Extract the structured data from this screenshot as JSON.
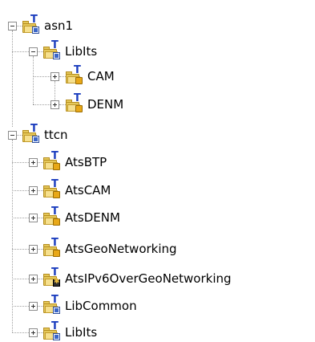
{
  "tree": {
    "asn1": {
      "label": "asn1",
      "children": {
        "libits": {
          "label": "LibIts",
          "children": {
            "cam": {
              "label": "CAM"
            },
            "denm": {
              "label": "DENM"
            }
          }
        }
      }
    },
    "ttcn": {
      "label": "ttcn",
      "children": {
        "atsbtp": {
          "label": "AtsBTP"
        },
        "atscam": {
          "label": "AtsCAM"
        },
        "atsdenm": {
          "label": "AtsDENM"
        },
        "atsgeonetworking": {
          "label": "AtsGeoNetworking"
        },
        "atsipv6": {
          "label": "AtsIPv6OverGeoNetworking"
        },
        "libcommon": {
          "label": "LibCommon"
        },
        "libits": {
          "label": "LibIts"
        }
      }
    }
  },
  "icons": {
    "folder_ttcn_package": "folder-t-package-icon",
    "folder_ttcn_jar": "folder-t-jar-icon",
    "folder_ttcn_star": "folder-t-star-icon"
  },
  "colors": {
    "folder": "#e5c85a",
    "t_glyph": "#1d3fbf",
    "tree_lines": "#a0a0a0"
  }
}
